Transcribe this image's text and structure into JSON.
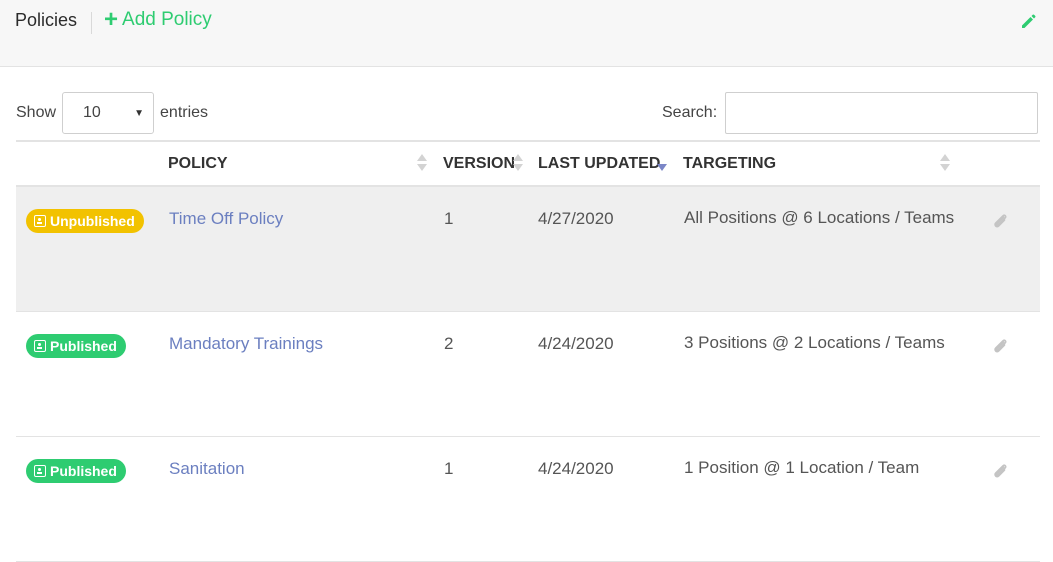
{
  "header": {
    "title": "Policies",
    "add_label": "Add Policy",
    "add_icon": "plus-icon",
    "edit_icon": "pencil-icon"
  },
  "controls": {
    "show_label": "Show",
    "entries_value": "10",
    "entries_label": "entries",
    "search_label": "Search:",
    "search_value": ""
  },
  "columns": {
    "policy": "POLICY",
    "version": "VERSION",
    "last_updated": "LAST UPDATED",
    "targeting": "TARGETING"
  },
  "rows": [
    {
      "status": "Unpublished",
      "policy": "Time Off Policy",
      "version": "1",
      "last_updated": "4/27/2020",
      "targeting": "All Positions @ 6 Locations / Teams"
    },
    {
      "status": "Published",
      "policy": "Mandatory Trainings",
      "version": "2",
      "last_updated": "4/24/2020",
      "targeting": "3 Positions @ 2 Locations / Teams"
    },
    {
      "status": "Published",
      "policy": "Sanitation",
      "version": "1",
      "last_updated": "4/24/2020",
      "targeting": "1 Position @ 1 Location / Team"
    }
  ],
  "colors": {
    "published": "#2ecc71",
    "unpublished": "#f2c200",
    "link": "#6b7fc0",
    "sort_active": "#7b86c7"
  }
}
